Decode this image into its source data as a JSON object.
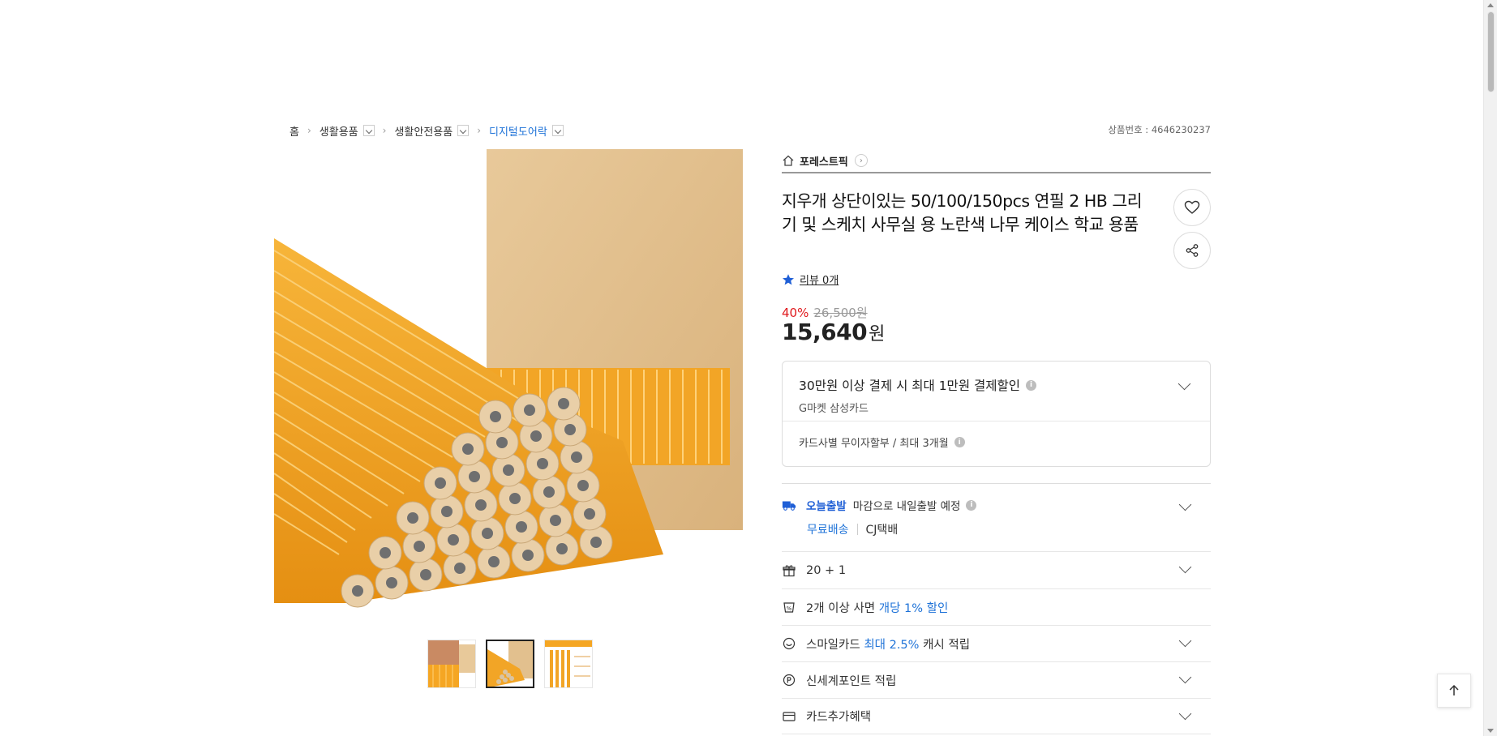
{
  "breadcrumb": {
    "items": [
      {
        "label": "홈"
      },
      {
        "label": "생활용품"
      },
      {
        "label": "생활안전용품"
      },
      {
        "label": "디지털도어락"
      }
    ]
  },
  "product_no": "상품번호 : 4646230237",
  "seller": {
    "name": "포레스트픽"
  },
  "product": {
    "title": "지우개 상단이있는 50/100/150pcs 연필 2 HB 그리기 및 스케치 사무실 용 노란색 나무 케이스 학교 용품",
    "review_text": "리뷰 0개",
    "discount_rate": "40%",
    "original_price": "26,500원",
    "price": "15,640",
    "price_unit": "원"
  },
  "card_benefit": {
    "headline": "30만원 이상 결제 시 최대 1만원 결제할인",
    "sub": "G마켓 삼성카드",
    "installment": "카드사별 무이자할부 / 최대 3개월",
    "info_glyph": "i"
  },
  "shipping": {
    "today_label": "오늘출발",
    "message": "마감으로 내일출발 예정",
    "free_label": "무료배송",
    "carrier": "CJ택배"
  },
  "benefits": {
    "bundle": "20 + 1",
    "multi_buy_prefix": "2개 이상 사면",
    "multi_buy_highlight": "개당 1% 할인",
    "smile_prefix": "스마일카드",
    "smile_highlight": "최대 2.5%",
    "smile_suffix": "캐시 적립",
    "ssg_point": "신세계포인트 적립",
    "card_extra": "카드추가혜택"
  },
  "colors": {
    "accent_blue": "#1f73d8",
    "sale_red": "#e0181c",
    "pencil_yellow": "#f5a623"
  },
  "icons": [
    "home-icon",
    "chevron-right-icon",
    "heart-icon",
    "share-icon",
    "star-icon",
    "info-icon",
    "truck-icon",
    "gift-icon",
    "discount-icon",
    "smile-icon",
    "point-icon",
    "card-icon",
    "chevron-down-icon",
    "arrow-up-icon"
  ]
}
